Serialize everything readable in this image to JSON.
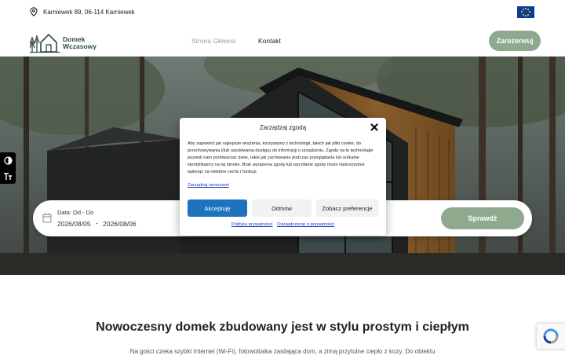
{
  "topbar": {
    "address": "Karniewek 89, 06-114 Karniewek",
    "pin_icon": "map-pin-icon",
    "flag_icon": "eu-flag-icon"
  },
  "header": {
    "logo_line1": "Domek",
    "logo_line2": "Wczasowy",
    "nav": {
      "home": "Strona Główna",
      "contact": "Kontakt"
    },
    "reserve_button": "Zarezerwuj"
  },
  "booking": {
    "date_label": "Data: Od - Do",
    "date_from": "2026/08/05",
    "separator": "-",
    "date_to": "2026/08/06",
    "check_button": "Sprawdź"
  },
  "consent": {
    "title": "Zarządzaj zgodą",
    "body": "Aby zapewnić jak najlepsze wrażenia, korzystamy z technologii, takich jak pliki cookie, do przechowywania i/lub uzyskiwania dostępu do informacji o urządzeniu. Zgoda na te technologie pozwoli nam przetwarzać dane, takie jak zachowanie podczas przeglądania lub unikalne identyfikatory na tej stronie. Brak wyrażenia zgody lub wycofanie zgody może niekorzystnie wpłynąć na niektóre cechy i funkcje.",
    "manage_link": "Zarządzaj serwisami",
    "accept": "Akceptuję",
    "deny": "Odmów",
    "preferences": "Zobacz preferencje",
    "privacy_link": "Polityka prywatności",
    "privacy_statement_link": "Oświadczenie o prywatności"
  },
  "content": {
    "heading": "Nowoczesny domek zbudowany jest w stylu prostym i ciepłym",
    "intro": "Na gości czeka szybki Internet (Wi-Fi), fotowoltaika zasilająca dom, a zimą przytulne ciepło z kozy. Do obiektu"
  },
  "colors": {
    "accent_green": "#8fa98f",
    "accept_blue": "#1e73be",
    "nav_active": "#8aa88e"
  }
}
